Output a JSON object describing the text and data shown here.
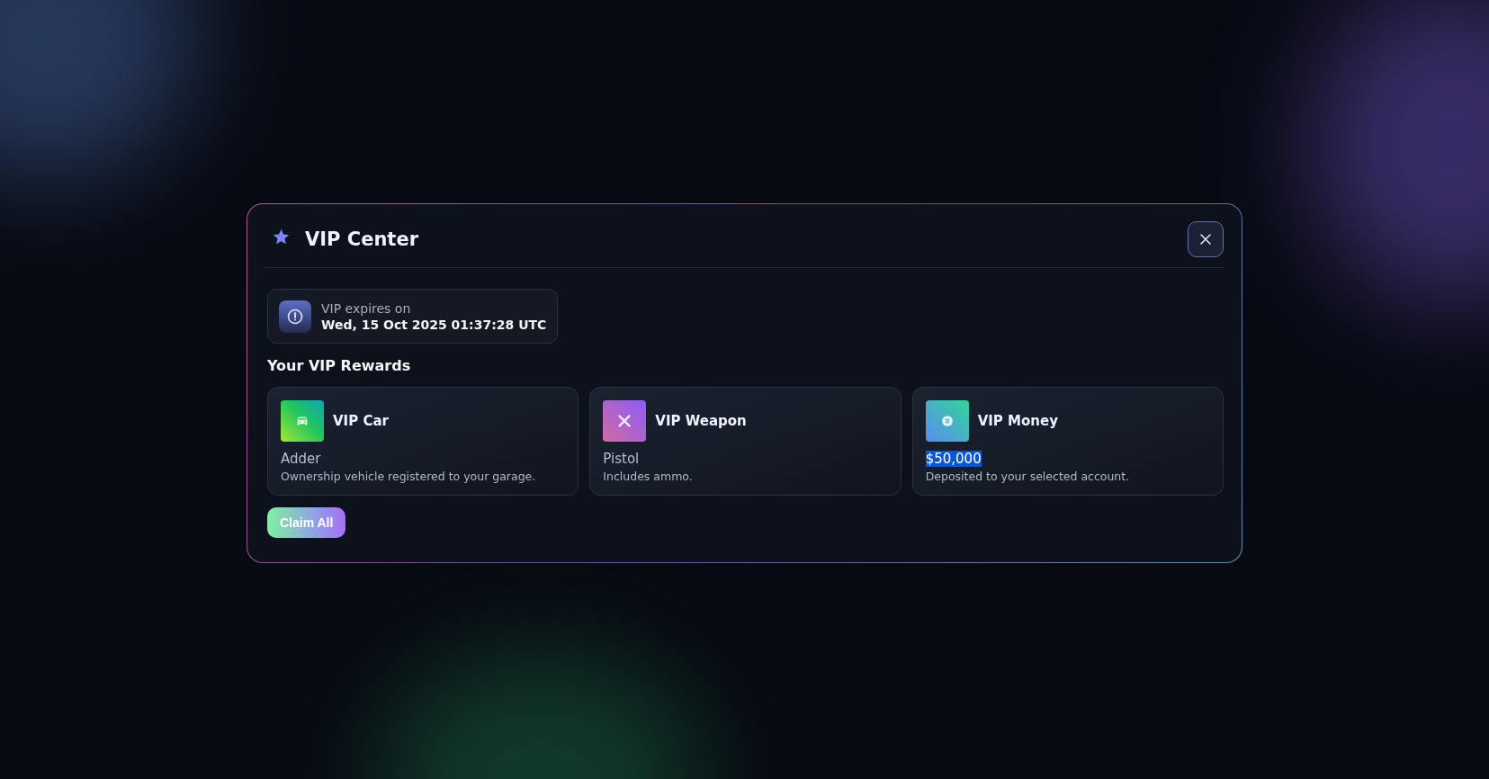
{
  "dialog": {
    "title": "VIP Center"
  },
  "expiry": {
    "label": "VIP expires on",
    "date": "Wed, 15 Oct 2025 01:37:28 UTC"
  },
  "rewards_heading": "Your VIP Rewards",
  "rewards": [
    {
      "kind": "car",
      "title": "VIP Car",
      "value": "Adder",
      "description": "Ownership vehicle registered to your garage.",
      "value_selected": false
    },
    {
      "kind": "weapon",
      "title": "VIP Weapon",
      "value": "Pistol",
      "description": "Includes ammo.",
      "value_selected": false
    },
    {
      "kind": "money",
      "title": "VIP Money",
      "value": "$50,000",
      "description": "Deposited to your selected account.",
      "value_selected": true
    }
  ],
  "claim_button": "Claim All"
}
